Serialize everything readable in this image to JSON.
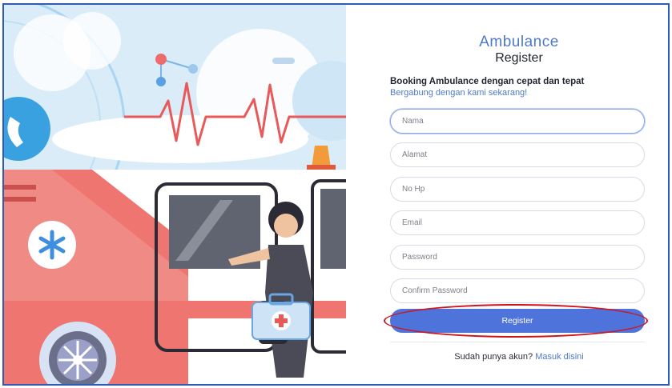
{
  "brand": {
    "title": "Ambulance",
    "subtitle": "Register"
  },
  "form": {
    "headline": "Booking Ambulance dengan cepat dan tepat",
    "subheadline": "Bergabung dengan kami sekarang!",
    "fields": [
      {
        "placeholder": "Nama",
        "value": ""
      },
      {
        "placeholder": "Alamat",
        "value": ""
      },
      {
        "placeholder": "No Hp",
        "value": ""
      },
      {
        "placeholder": "Email",
        "value": ""
      },
      {
        "placeholder": "Password",
        "value": ""
      },
      {
        "placeholder": "Confirm Password",
        "value": ""
      }
    ],
    "submit_label": "Register"
  },
  "footer": {
    "prompt": "Sudah punya akun?",
    "link_label": "Masuk disini"
  },
  "colors": {
    "accent": "#4e74dc",
    "brand_blue": "#4f79c9",
    "highlight_ring": "#d0141e",
    "frame_border": "#2f5bb7"
  },
  "illustration": {
    "icons": [
      "heartbeat-line-icon",
      "ambulance-icon",
      "medical-star-icon",
      "first-aid-kit-icon",
      "siren-icon",
      "wheel-icon"
    ]
  }
}
